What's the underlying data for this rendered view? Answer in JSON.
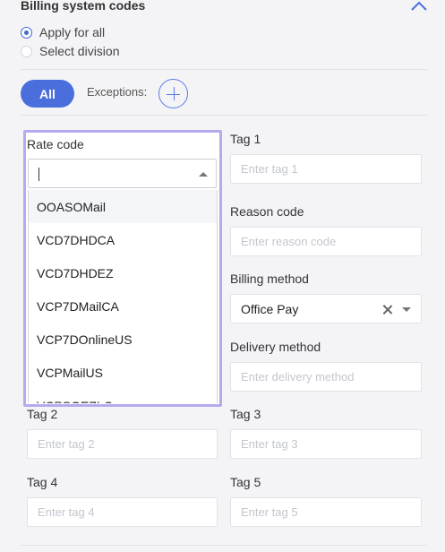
{
  "section": {
    "title": "Billing system codes"
  },
  "scope": {
    "apply_all": "Apply for all",
    "select_division": "Select division",
    "selected": "apply_all"
  },
  "filter": {
    "all_label": "All",
    "exceptions_label": "Exceptions:"
  },
  "rate_code": {
    "label": "Rate code",
    "value": "",
    "options": [
      "OOASOMail",
      "VCD7DHDCA",
      "VCD7DHDEZ",
      "VCP7DMailCA",
      "VCP7DOnlineUS",
      "VCPMailUS",
      "VCPSOEZLC"
    ]
  },
  "fields": {
    "tag1": {
      "label": "Tag 1",
      "placeholder": "Enter tag 1"
    },
    "reason_code": {
      "label": "Reason code",
      "placeholder": "Enter reason code"
    },
    "billing_method": {
      "label": "Billing method",
      "value": "Office Pay"
    },
    "delivery_method": {
      "label": "Delivery method",
      "placeholder": "Enter delivery method"
    },
    "tag2": {
      "label": "Tag 2",
      "placeholder": "Enter tag 2"
    },
    "tag3": {
      "label": "Tag 3",
      "placeholder": "Enter tag 3"
    },
    "tag4": {
      "label": "Tag 4",
      "placeholder": "Enter tag 4"
    },
    "tag5": {
      "label": "Tag 5",
      "placeholder": "Enter tag 5"
    }
  },
  "icons": {
    "collapse": "chevron-up-icon",
    "add": "plus-circle-icon",
    "clear": "close-icon",
    "dropdown": "caret-down-icon"
  },
  "colors": {
    "accent": "#4a6fdc",
    "focus_outline": "#b8a9ee",
    "background": "#f4f4f7"
  }
}
